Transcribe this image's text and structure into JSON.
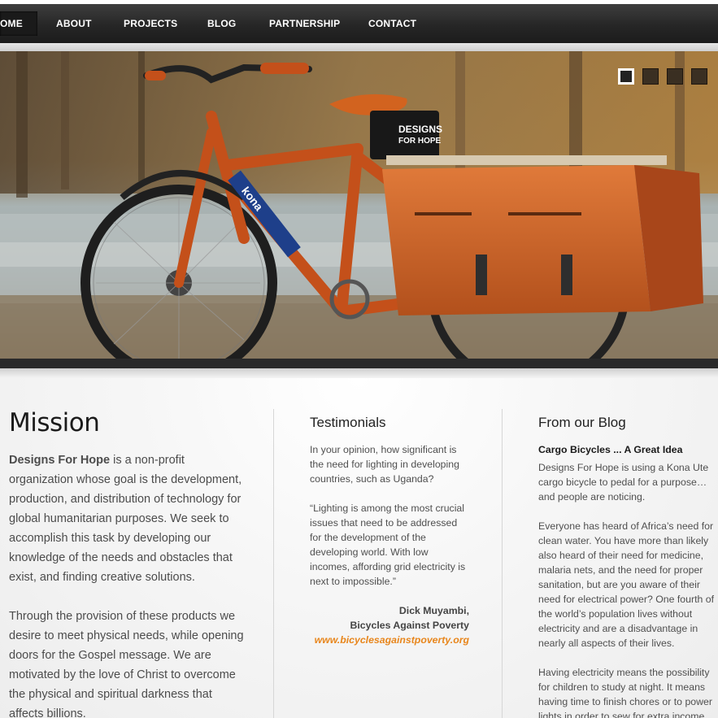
{
  "nav": {
    "items": [
      "OME",
      "ABOUT",
      "PROJECTS",
      "BLOG",
      "PARTNERSHIP",
      "CONTACT"
    ]
  },
  "hero": {
    "bag_logo_line1": "DESIGNS",
    "bag_logo_line2": "FOR HOPE",
    "frame_brand": "kona",
    "slide_count": 4,
    "active_slide": 1
  },
  "mission": {
    "title": "Mission",
    "org_name": "Designs For Hope",
    "para1_rest": " is a non-profit organization whose goal is the development, production, and distribution of technology for global humanitarian purposes. We seek to accomplish this task by developing our knowledge of the needs and obstacles that exist, and finding creative solutions.",
    "para2": "Through the provision of these products we desire to meet physical needs, while opening doors for the Gospel message. We are motivated by the love of Christ to overcome the physical and spiritual darkness that affects billions."
  },
  "testimonials": {
    "title": "Testimonials",
    "question": "In your opinion, how significant is the need for lighting in developing countries, such as Uganda?",
    "quote": "“Lighting is among the most crucial issues that need to be addressed for the development of the developing world. With low incomes, affording grid electricity is next to impossible.”",
    "author": "Dick Muyambi,",
    "organization": "Bicycles Against Poverty",
    "link": "www.bicyclesagainstpoverty.org"
  },
  "blog": {
    "title": "From our Blog",
    "post_title": "Cargo Bicycles ... A Great Idea",
    "para1": "Designs For Hope is using a Kona Ute cargo bicycle to pedal for a purpose…and people are noticing.",
    "para2": "Everyone has heard of Africa’s need for clean water. You have more than likely also heard of their need for medicine, malaria nets, and the need for proper sanitation, but are you aware of their need for electrical power? One fourth of the world’s population lives without electricity and are a disadvantage in nearly all aspects of their lives.",
    "para3": "Having electricity means the possibility for children to study at night. It means having time to finish chores or to power lights in order to sew for extra income. It"
  },
  "colors": {
    "accent_link": "#e8861c",
    "nav_bg": "#262626",
    "bike_orange": "#c4501a"
  }
}
